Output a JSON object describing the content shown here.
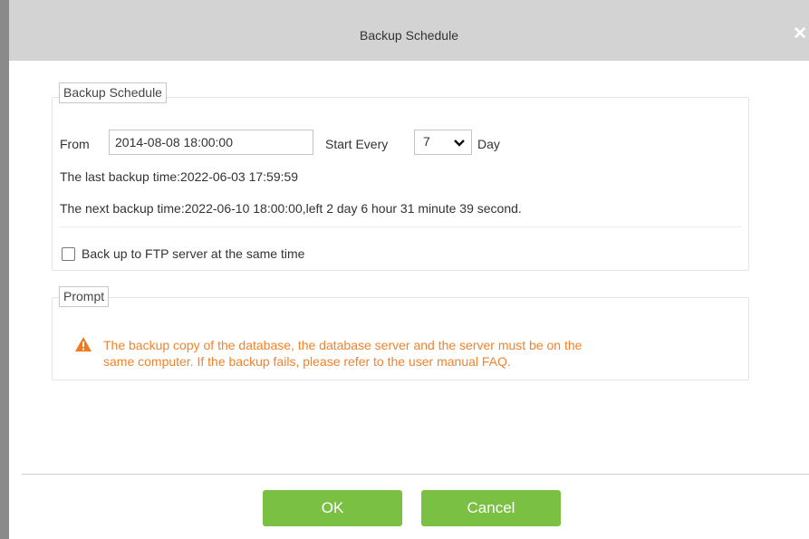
{
  "dialog": {
    "title": "Backup Schedule",
    "close_icon": "close-icon"
  },
  "schedule": {
    "legend": "Backup Schedule",
    "from_label": "From",
    "from_value": "2014-08-08 18:00:00",
    "start_every_label": "Start Every",
    "interval_value": "7",
    "interval_unit": "Day",
    "last_backup": "The last backup time:2022-06-03 17:59:59",
    "next_backup": "The next backup time:2022-06-10 18:00:00,left 2 day 6 hour 31 minute 39 second.",
    "ftp_label": "Back up to FTP server at the same time",
    "ftp_checked": false
  },
  "prompt": {
    "legend": "Prompt",
    "icon": "warning-icon",
    "line1": "The backup copy of the database, the database server and the server must be on the",
    "line2": "same computer. If the backup fails, please refer to the user manual FAQ.",
    "color": "#f0832d"
  },
  "footer": {
    "ok_label": "OK",
    "cancel_label": "Cancel",
    "button_color": "#7ac143"
  }
}
